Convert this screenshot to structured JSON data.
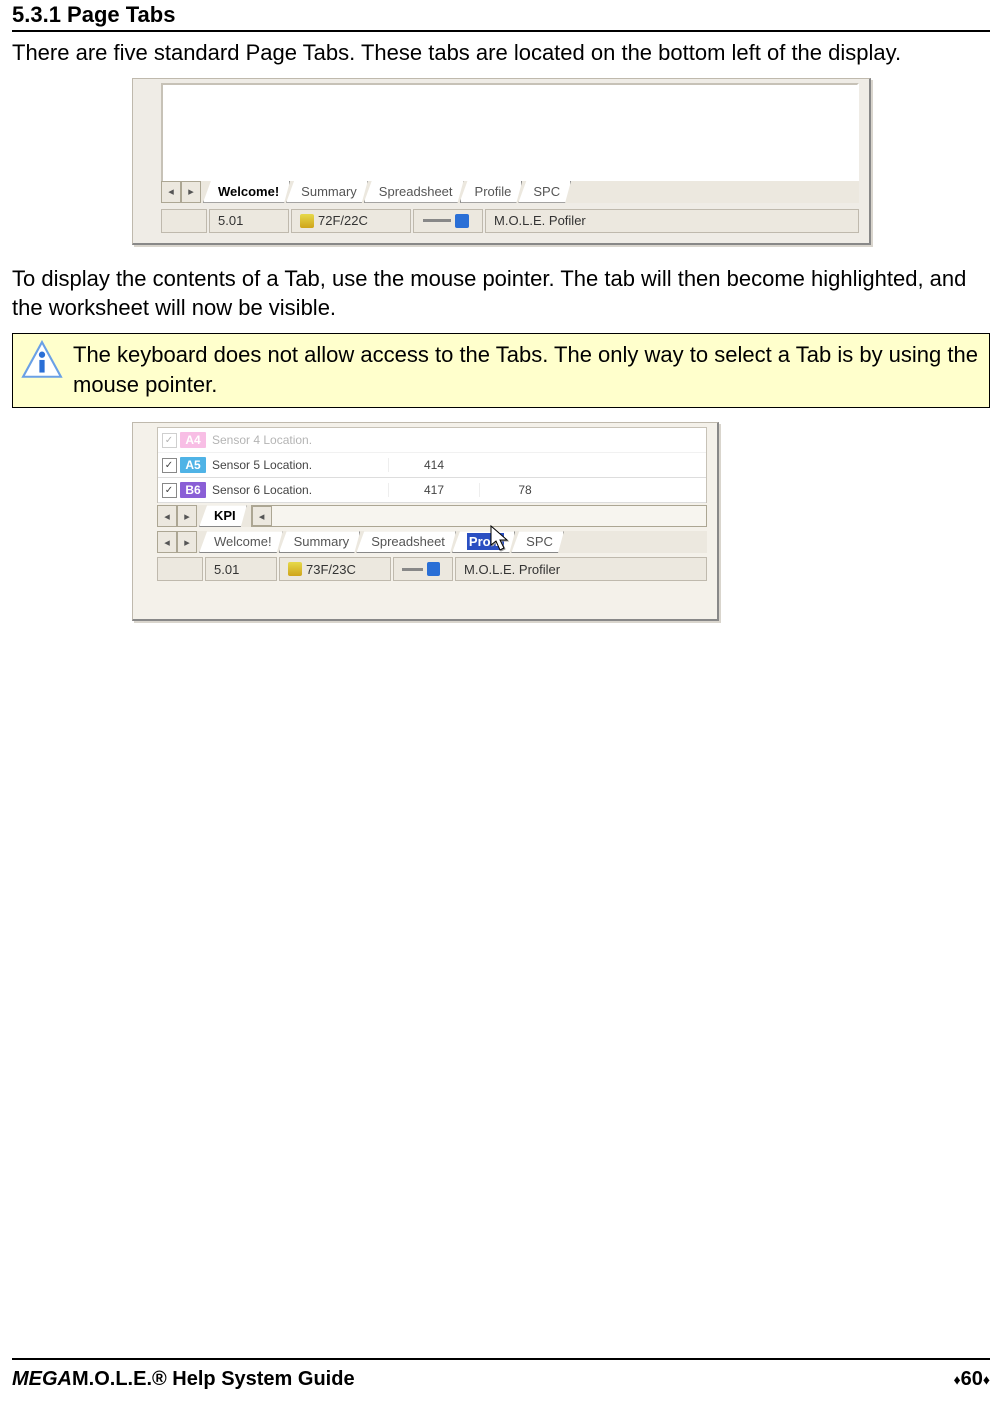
{
  "heading": "5.3.1 Page Tabs",
  "para1": "There are five standard Page Tabs. These tabs are located on the bottom left of the display.",
  "para2": "To display the contents of a Tab, use the mouse pointer. The tab will then become highlighted, and the worksheet will now be visible.",
  "note": "The keyboard does not allow access to the Tabs. The only way to select a Tab is by using the mouse pointer.",
  "fig1": {
    "nav_left": "◂",
    "nav_right": "▸",
    "tabs": [
      "Welcome!",
      "Summary",
      "Spreadsheet",
      "Profile",
      "SPC"
    ],
    "status_version": "5.01",
    "status_temp": "72F/22C",
    "status_app": "M.O.L.E. Pofiler"
  },
  "fig2": {
    "rows": [
      {
        "tag": "A4",
        "loc": "Sensor 4 Location.",
        "c1": "",
        "c2": ""
      },
      {
        "tag": "A5",
        "loc": "Sensor 5 Location.",
        "c1": "414",
        "c2": ""
      },
      {
        "tag": "B6",
        "loc": "Sensor 6 Location.",
        "c1": "417",
        "c2": "78"
      }
    ],
    "kpi_nav_left": "◂",
    "kpi_nav_right": "▸",
    "kpi_label": "KPI",
    "scroll_nav": "◂",
    "tabs": [
      "Welcome!",
      "Summary",
      "Spreadsheet",
      "Profile",
      "SPC"
    ],
    "highlight_tab_short": "Profil",
    "status_version": "5.01",
    "status_temp": "73F/23C",
    "status_app": "M.O.L.E. Profiler"
  },
  "footer": {
    "italic": "MEGA",
    "bold": "M.O.L.E.® Help System Guide",
    "page": "60"
  }
}
